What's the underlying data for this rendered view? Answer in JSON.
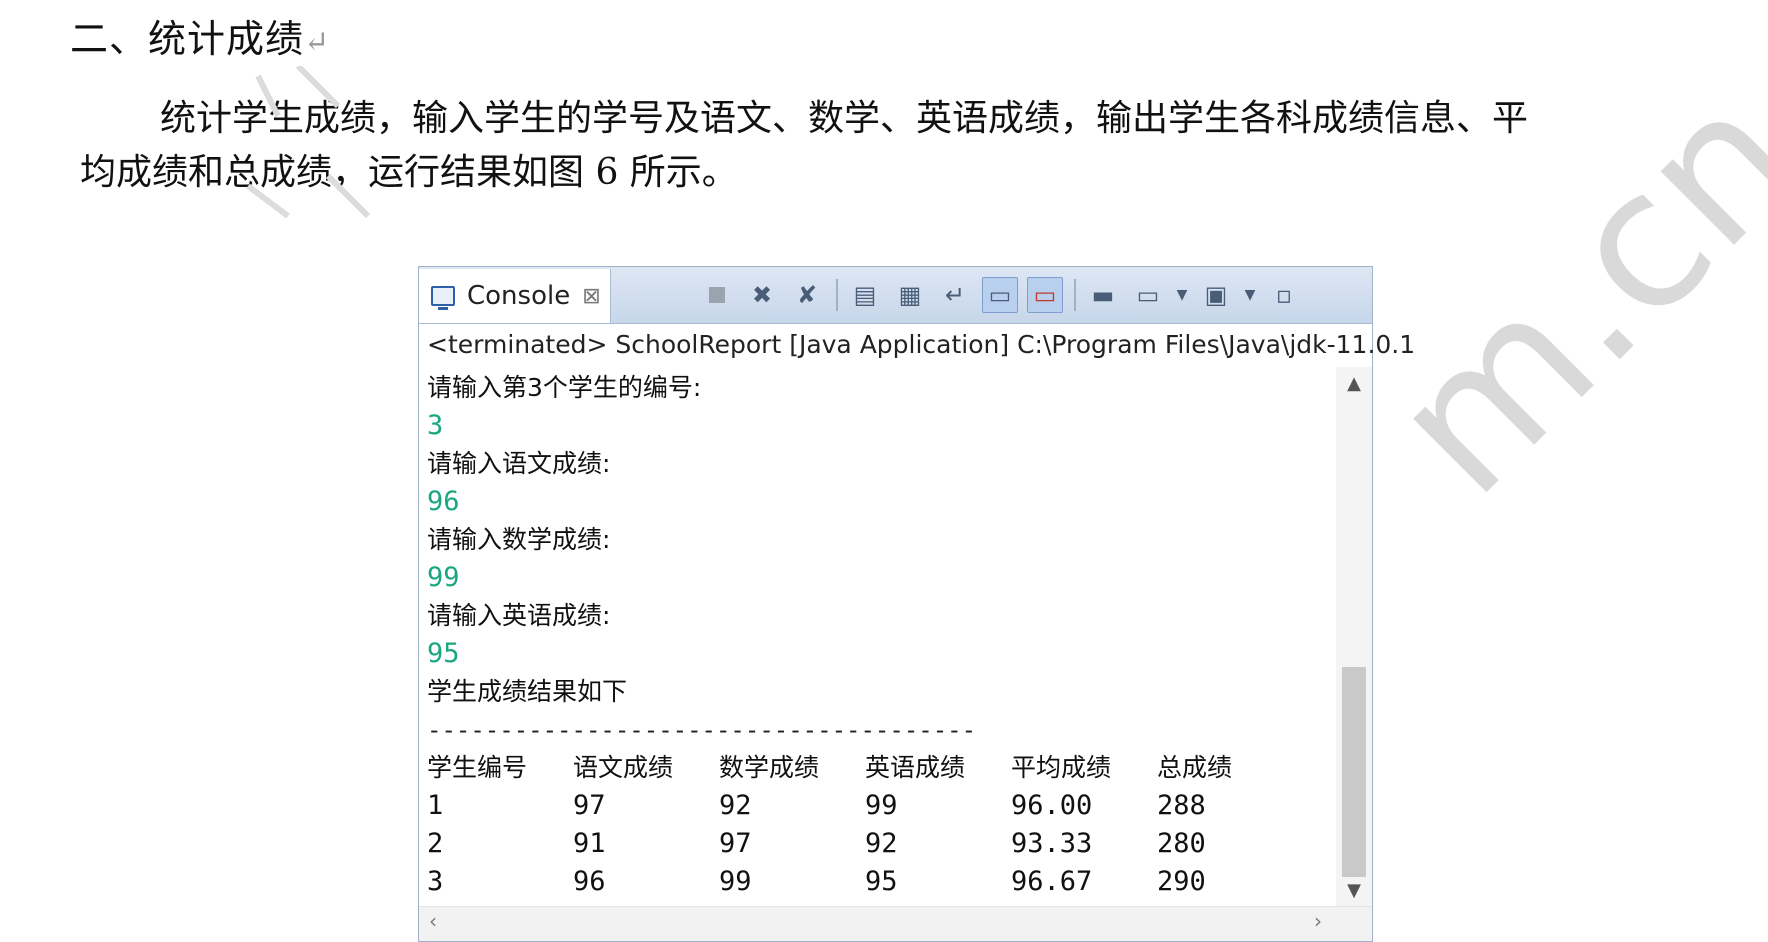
{
  "document": {
    "heading": "二、统计成绩",
    "paragraph_line1": "统计学生成绩，输入学生的学号及语文、数学、英语成绩，输出学生各科成绩信息、平",
    "paragraph_line2": "均成绩和总成绩，运行结果如图 6 所示。",
    "watermark": "m.cn"
  },
  "console": {
    "tab_label": "Console",
    "tab_close": "⊠",
    "toolbar_icons": [
      "terminate-icon",
      "remove-launch-icon",
      "remove-all-icon",
      "clear-console-icon",
      "scroll-lock-icon",
      "word-wrap-icon",
      "show-on-stdout-icon",
      "show-on-stderr-icon",
      "pin-console-icon",
      "display-console-icon",
      "new-console-icon",
      "minimize-icon"
    ],
    "status": "<terminated> SchoolReport [Java Application] C:\\Program Files\\Java\\jdk-11.0.1",
    "lines": [
      {
        "text": "请输入第3个学生的编号:",
        "kind": "prompt"
      },
      {
        "text": "3",
        "kind": "input"
      },
      {
        "text": "请输入语文成绩:",
        "kind": "prompt"
      },
      {
        "text": "96",
        "kind": "input"
      },
      {
        "text": "请输入数学成绩:",
        "kind": "prompt"
      },
      {
        "text": "99",
        "kind": "input"
      },
      {
        "text": "请输入英语成绩:",
        "kind": "prompt"
      },
      {
        "text": "95",
        "kind": "input"
      },
      {
        "text": "学生成绩结果如下",
        "kind": "prompt"
      }
    ],
    "separator": "--------------------------------------",
    "table_headers": [
      "学生编号",
      "语文成绩",
      "数学成绩",
      "英语成绩",
      "平均成绩",
      "总成绩"
    ],
    "table_rows": [
      [
        "1",
        "97",
        "92",
        "99",
        "96.00",
        "288"
      ],
      [
        "2",
        "91",
        "97",
        "92",
        "93.33",
        "280"
      ],
      [
        "3",
        "96",
        "99",
        "95",
        "96.67",
        "290"
      ]
    ],
    "colors": {
      "input_text": "#1aa77f",
      "toolbar": "#c7d6ea"
    }
  }
}
